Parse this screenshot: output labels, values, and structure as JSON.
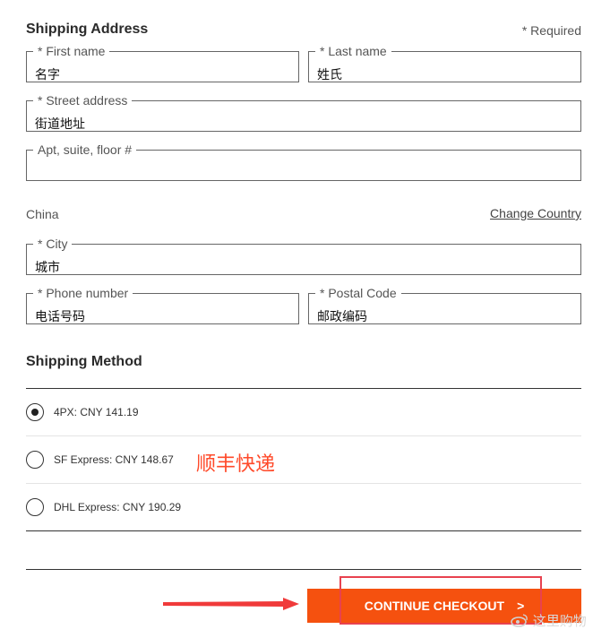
{
  "shipping_address": {
    "title": "Shipping Address",
    "required_note": "* Required",
    "first_name": {
      "label": "* First name",
      "value": "名字"
    },
    "last_name": {
      "label": "* Last name",
      "value": "姓氏"
    },
    "street": {
      "label": "* Street address",
      "value": "街道地址"
    },
    "apt": {
      "label": "Apt, suite, floor #",
      "value": ""
    },
    "country": "China",
    "change_country": "Change Country",
    "city": {
      "label": "* City",
      "value": "城市"
    },
    "phone": {
      "label": "* Phone number",
      "value": "电话号码"
    },
    "postal": {
      "label": "* Postal Code",
      "value": "邮政编码"
    }
  },
  "shipping_method": {
    "title": "Shipping Method",
    "options": [
      {
        "label": "4PX: CNY 141.19",
        "selected": true
      },
      {
        "label": "SF Express: CNY 148.67",
        "selected": false
      },
      {
        "label": "DHL Express: CNY 190.29",
        "selected": false
      }
    ],
    "annotation": "顺丰快递"
  },
  "checkout": {
    "label": "CONTINUE CHECKOUT",
    "chevron": ">"
  },
  "watermark": "这里购物",
  "colors": {
    "accent": "#f5510f",
    "annotation": "#ff4a2a",
    "highlight_box": "#e8424f"
  }
}
